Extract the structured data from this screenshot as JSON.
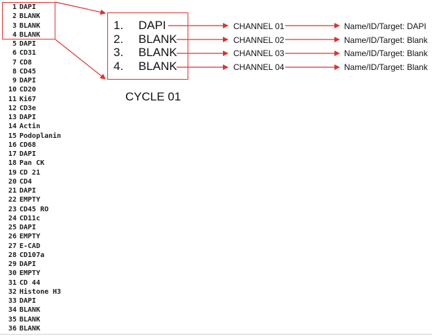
{
  "listing": [
    {
      "n": "1",
      "label": "DAPI"
    },
    {
      "n": "2",
      "label": "BLANK"
    },
    {
      "n": "3",
      "label": "BLANK"
    },
    {
      "n": "4",
      "label": "BLANK"
    },
    {
      "n": "5",
      "label": "DAPI"
    },
    {
      "n": "6",
      "label": "CD31"
    },
    {
      "n": "7",
      "label": "CD8"
    },
    {
      "n": "8",
      "label": "CD45"
    },
    {
      "n": "9",
      "label": "DAPI"
    },
    {
      "n": "10",
      "label": "CD20"
    },
    {
      "n": "11",
      "label": "Ki67"
    },
    {
      "n": "12",
      "label": "CD3e"
    },
    {
      "n": "13",
      "label": "DAPI"
    },
    {
      "n": "14",
      "label": "Actin"
    },
    {
      "n": "15",
      "label": "Podoplanin"
    },
    {
      "n": "16",
      "label": "CD68"
    },
    {
      "n": "17",
      "label": "DAPI"
    },
    {
      "n": "18",
      "label": "Pan CK"
    },
    {
      "n": "19",
      "label": "CD 21"
    },
    {
      "n": "20",
      "label": "CD4"
    },
    {
      "n": "21",
      "label": "DAPI"
    },
    {
      "n": "22",
      "label": "EMPTY"
    },
    {
      "n": "23",
      "label": "CD45 RO"
    },
    {
      "n": "24",
      "label": "CD11c"
    },
    {
      "n": "25",
      "label": "DAPI"
    },
    {
      "n": "26",
      "label": "EMPTY"
    },
    {
      "n": "27",
      "label": "E-CAD"
    },
    {
      "n": "28",
      "label": "CD107a"
    },
    {
      "n": "29",
      "label": "DAPI"
    },
    {
      "n": "30",
      "label": "EMPTY"
    },
    {
      "n": "31",
      "label": "CD 44"
    },
    {
      "n": "32",
      "label": "Histone H3"
    },
    {
      "n": "33",
      "label": "DAPI"
    },
    {
      "n": "34",
      "label": "BLANK"
    },
    {
      "n": "35",
      "label": "BLANK"
    },
    {
      "n": "36",
      "label": "BLANK"
    }
  ],
  "cycle": {
    "label": "CYCLE 01",
    "items": [
      {
        "num": "1.",
        "name": "DAPI",
        "channel": "CHANNEL 01",
        "target": "Name/ID/Target: DAPI"
      },
      {
        "num": "2.",
        "name": "BLANK",
        "channel": "CHANNEL 02",
        "target": "Name/ID/Target: Blank"
      },
      {
        "num": "3.",
        "name": "BLANK",
        "channel": "CHANNEL 03",
        "target": "Name/ID/Target: Blank"
      },
      {
        "num": "4.",
        "name": "BLANK",
        "channel": "CHANNEL 04",
        "target": "Name/ID/Target: Blank"
      }
    ]
  },
  "colors": {
    "arrow": "#e03030",
    "text": "#111111"
  }
}
